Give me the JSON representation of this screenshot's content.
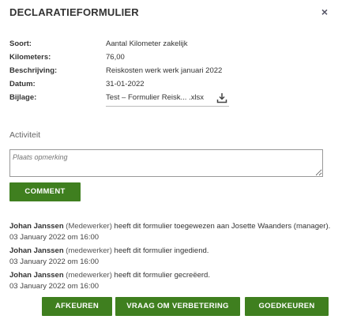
{
  "header": {
    "title": "DECLARATIEFORMULIER",
    "close_label": "×"
  },
  "details": [
    {
      "label": "Soort:",
      "value": "Aantal Kilometer zakelijk"
    },
    {
      "label": "Kilometers:",
      "value": "76,00"
    },
    {
      "label": "Beschrijving:",
      "value": "Reiskosten werk werk januari 2022"
    },
    {
      "label": "Datum:",
      "value": "31-01-2022"
    },
    {
      "label": "Bijlage:",
      "value": "Test – Formulier Reisk... .xlsx"
    }
  ],
  "activity": {
    "label": "Activiteit",
    "placeholder": "Plaats opmerking",
    "comment_button": "COMMENT"
  },
  "log": [
    {
      "name": "Johan Janssen",
      "role": "(Medewerker)",
      "text": "heeft dit formulier toegewezen aan Josette Waanders (manager).",
      "date": "03 January 2022 om 16:00"
    },
    {
      "name": "Johan Janssen",
      "role": "(medewerker)",
      "text": "heeft dit formulier ingediend.",
      "date": "03 January 2022 om 16:00"
    },
    {
      "name": "Johan Janssen",
      "role": "(medewerker)",
      "text": "heeft dit formulier gecreëerd.",
      "date": "03 January 2022 om 16:00"
    }
  ],
  "actions": {
    "reject": "AFKEUREN",
    "improve": "VRAAG OM VERBETERING",
    "approve": "GOEDKEUREN"
  },
  "colors": {
    "button_bg": "#3f7f1f",
    "button_text": "#ffffff"
  }
}
